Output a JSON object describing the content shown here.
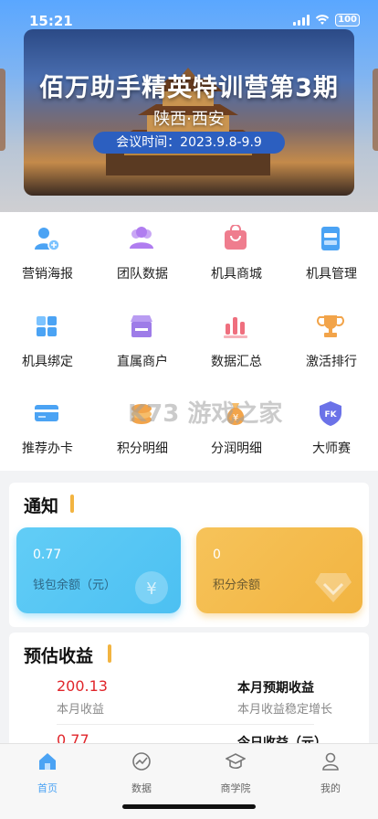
{
  "status_bar": {
    "time": "15:21",
    "battery": "100"
  },
  "banner": {
    "title": "佰万助手精英特训营第3期",
    "subtitle": "陕西·西安",
    "date_pill": "会议时间：2023.9.8-9.9"
  },
  "grid": [
    {
      "label": "营销海报",
      "icon": "user-add-icon",
      "color": "#4ba3f4"
    },
    {
      "label": "团队数据",
      "icon": "team-icon",
      "color": "#b07df0"
    },
    {
      "label": "机具商城",
      "icon": "shopping-bag-icon",
      "color": "#ef7d8e"
    },
    {
      "label": "机具管理",
      "icon": "stack-icon",
      "color": "#4ba3f4"
    },
    {
      "label": "机具绑定",
      "icon": "bind-icon",
      "color": "#4ba3f4"
    },
    {
      "label": "直属商户",
      "icon": "store-icon",
      "color": "#9e7ce8"
    },
    {
      "label": "数据汇总",
      "icon": "bar-chart-icon",
      "color": "#ef6f7e"
    },
    {
      "label": "激活排行",
      "icon": "trophy-icon",
      "color": "#f2a44a"
    },
    {
      "label": "推荐办卡",
      "icon": "card-icon",
      "color": "#4ba3f4"
    },
    {
      "label": "积分明细",
      "icon": "coins-icon",
      "color": "#f2a44a"
    },
    {
      "label": "分润明细",
      "icon": "money-bag-icon",
      "color": "#f2a44a"
    },
    {
      "label": "大师赛",
      "icon": "shield-icon",
      "color": "#6b72e8"
    }
  ],
  "notice": {
    "title": "通知",
    "wallet": {
      "amount": "0.77",
      "label": "钱包余额（元）"
    },
    "points": {
      "amount": "0",
      "label": "积分余额"
    }
  },
  "earnings": {
    "title": "预估收益",
    "month_value": "200.13",
    "month_label": "本月收益",
    "month_forecast_title": "本月预期收益",
    "month_forecast_sub": "本月收益稳定增长",
    "today_value": "0.77",
    "today_title": "今日收益（元）"
  },
  "tabbar": [
    {
      "label": "首页",
      "icon": "home-icon",
      "active": true
    },
    {
      "label": "数据",
      "icon": "chart-icon",
      "active": false
    },
    {
      "label": "商学院",
      "icon": "graduation-cap-icon",
      "active": false
    },
    {
      "label": "我的",
      "icon": "profile-icon",
      "active": false
    }
  ],
  "watermark": "K73 游戏之家"
}
